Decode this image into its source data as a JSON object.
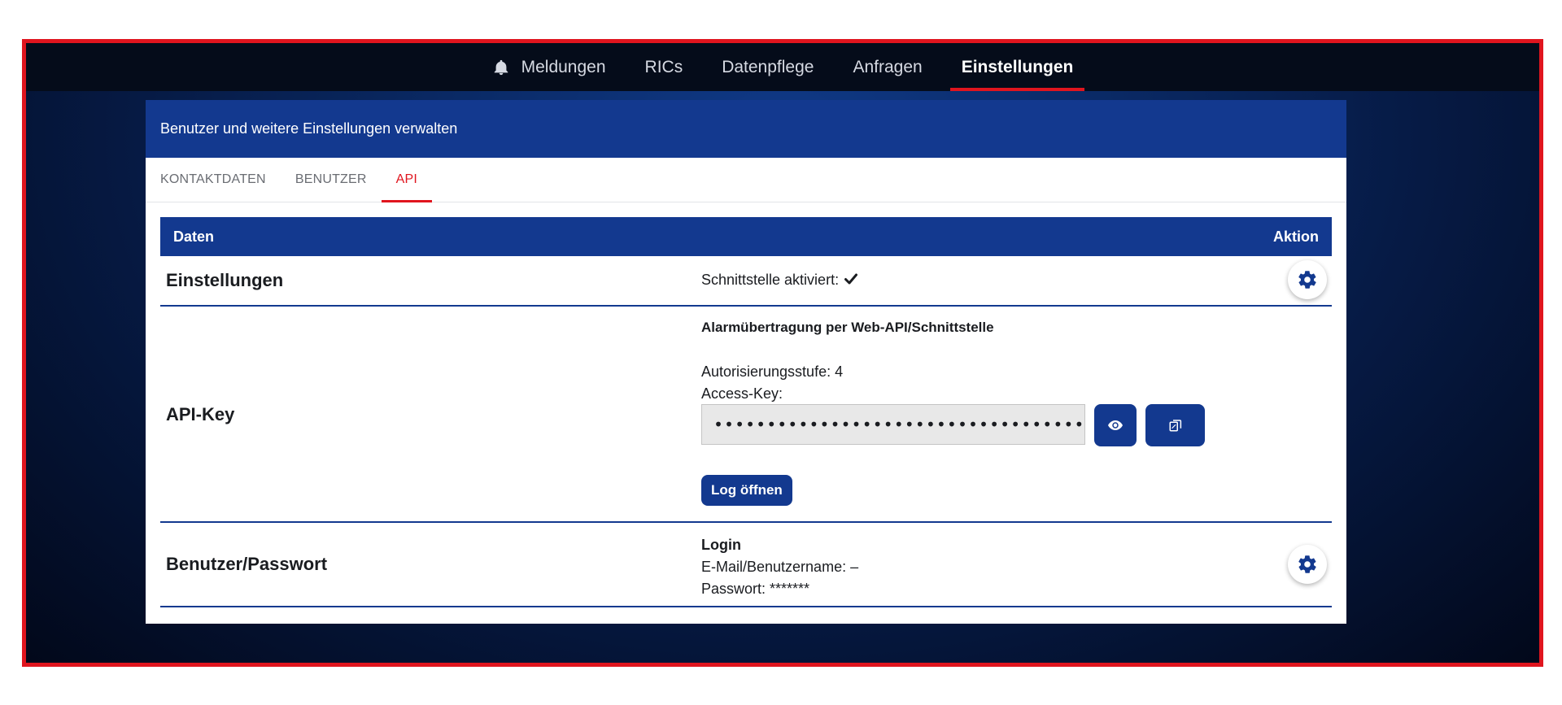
{
  "topnav": {
    "items": [
      {
        "label": "Meldungen",
        "icon": "bell-icon"
      },
      {
        "label": "RICs"
      },
      {
        "label": "Datenpflege"
      },
      {
        "label": "Anfragen"
      },
      {
        "label": "Einstellungen",
        "active": true
      }
    ]
  },
  "panel": {
    "title": "Benutzer und weitere Einstellungen verwalten",
    "tabs": [
      {
        "label": "KONTAKTDATEN"
      },
      {
        "label": "BENUTZER"
      },
      {
        "label": "API",
        "active": true
      }
    ]
  },
  "table": {
    "headers": {
      "data": "Daten",
      "action": "Aktion"
    },
    "rows": {
      "settings": {
        "label": "Einstellungen",
        "status": "Schnittstelle aktiviert:",
        "status_icon": "checkmark-icon"
      },
      "apikey": {
        "label": "API-Key",
        "title": "Alarmübertragung per Web-API/Schnittstelle",
        "level": "Autorisierungsstufe: 4",
        "access_key_label": "Access-Key:",
        "access_key_value": "••••••••••••••••••••••••••••••••••••••••",
        "show_icon": "eye-icon",
        "copy_icon": "copy-icon",
        "log_button": "Log öffnen"
      },
      "login": {
        "label": "Benutzer/Passwort",
        "title": "Login",
        "email": "E-Mail/Benutzername: –",
        "password": "Passwort: *******"
      }
    }
  },
  "colors": {
    "primary": "#13398f",
    "accent": "#e0151e",
    "nav_bg": "#050c1a"
  }
}
